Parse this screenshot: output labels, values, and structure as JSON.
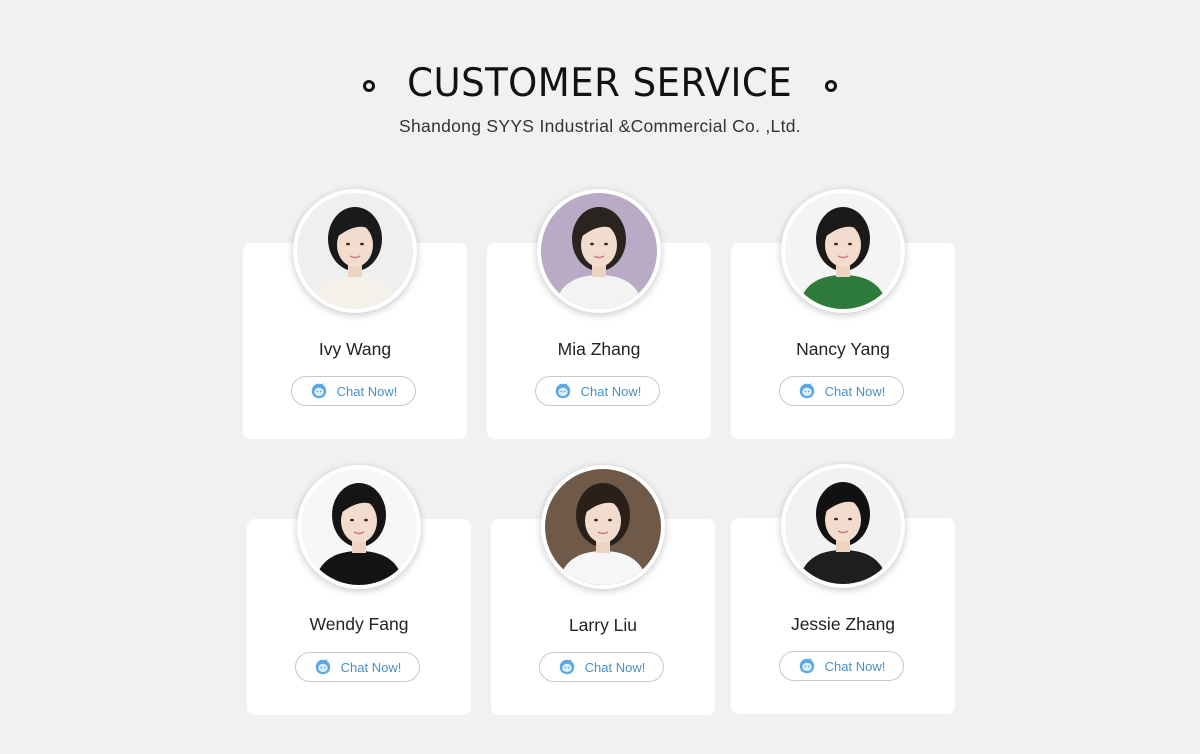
{
  "header": {
    "title": "CUSTOMER SERVICE",
    "subtitle": "Shandong SYYS Industrial &Commercial Co. ,Ltd."
  },
  "colors": {
    "background": "#f1f1f1",
    "card": "#ffffff",
    "chat_text": "#4a90c8",
    "chat_icon": "#5aa9e6"
  },
  "agents": [
    {
      "name": "Ivy Wang",
      "chat_label": "Chat Now!",
      "chat_icon": "chat-bubble-icon",
      "bg_color": "#efefef",
      "hair_color": "#1a1a1a",
      "top_color": "#f4f0ea"
    },
    {
      "name": "Mia Zhang",
      "chat_label": "Chat Now!",
      "chat_icon": "chat-bubble-icon",
      "bg_color": "#b9aac6",
      "hair_color": "#2a2420",
      "top_color": "#f3f3f3"
    },
    {
      "name": "Nancy Yang",
      "chat_label": "Chat Now!",
      "chat_icon": "chat-bubble-icon",
      "bg_color": "#f4f4f4",
      "hair_color": "#1c1a18",
      "top_color": "#2e7a3a"
    },
    {
      "name": "Wendy Fang",
      "chat_label": "Chat Now!",
      "chat_icon": "chat-bubble-icon",
      "bg_color": "#f7f7f7",
      "hair_color": "#151515",
      "top_color": "#141414"
    },
    {
      "name": "Larry Liu",
      "chat_label": "Chat Now!",
      "chat_icon": "chat-bubble-icon",
      "bg_color": "#6f5a4a",
      "hair_color": "#2a201a",
      "top_color": "#f6f6f6"
    },
    {
      "name": "Jessie Zhang",
      "chat_label": "Chat Now!",
      "chat_icon": "chat-bubble-icon",
      "bg_color": "#f2f2f2",
      "hair_color": "#111111",
      "top_color": "#1e1e1e"
    }
  ]
}
